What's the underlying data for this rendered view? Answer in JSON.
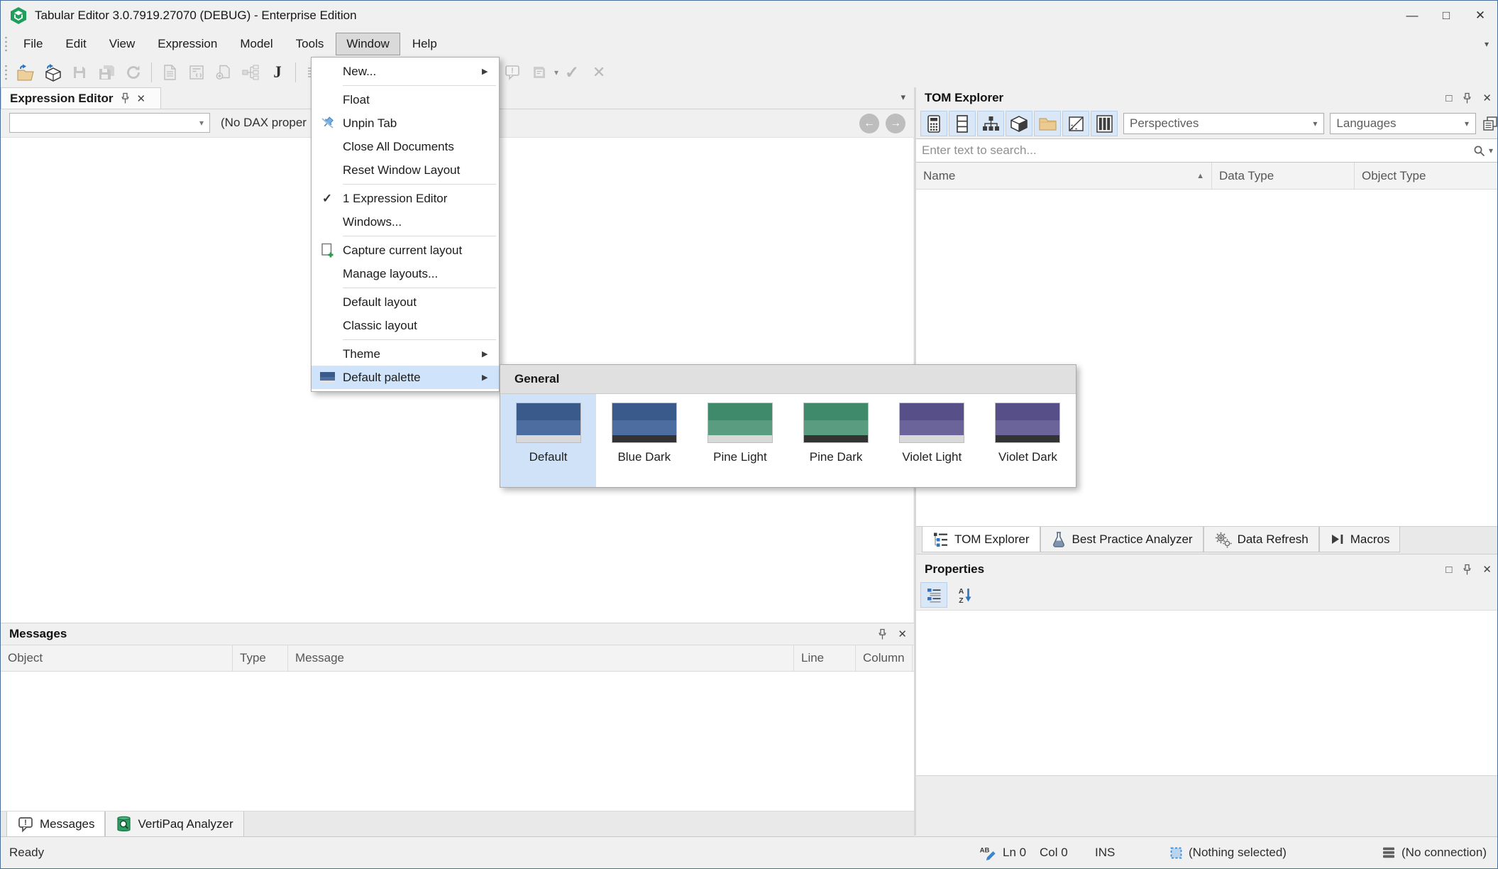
{
  "window": {
    "title": "Tabular Editor 3.0.7919.27070 (DEBUG) - Enterprise Edition",
    "minimize": "—",
    "maximize": "□",
    "close": "✕"
  },
  "menu_bar": {
    "items": [
      "File",
      "Edit",
      "View",
      "Expression",
      "Model",
      "Tools",
      "Window",
      "Help"
    ],
    "active": "Window"
  },
  "toolbar": {
    "items": [
      {
        "icon": "open-file",
        "disabled": false
      },
      {
        "icon": "open-db",
        "disabled": false
      },
      {
        "icon": "save",
        "disabled": true
      },
      {
        "icon": "save-all",
        "disabled": true
      },
      {
        "icon": "refresh",
        "disabled": true
      },
      {
        "sep": true
      },
      {
        "icon": "new-doc",
        "disabled": true
      },
      {
        "icon": "doc-script",
        "disabled": true
      },
      {
        "icon": "doc-import",
        "disabled": true
      },
      {
        "icon": "org-chart",
        "disabled": true
      },
      {
        "icon": "dax-script",
        "disabled": false
      },
      {
        "sep": true
      },
      {
        "icon": "format-lines",
        "disabled": true
      },
      {
        "gap": 242
      },
      {
        "icon": "message-bubble",
        "disabled": true
      },
      {
        "icon": "save-layout",
        "disabled": true,
        "caret": true
      },
      {
        "icon": "check",
        "disabled": true
      },
      {
        "icon": "cancel-x",
        "disabled": true
      }
    ]
  },
  "window_menu": {
    "items": [
      {
        "label": "New...",
        "submenu": true
      },
      {
        "separator": true
      },
      {
        "label": "Float"
      },
      {
        "label": "Unpin Tab",
        "icon": "unpin"
      },
      {
        "label": "Close All Documents"
      },
      {
        "label": "Reset Window Layout"
      },
      {
        "separator": true
      },
      {
        "label": "1 Expression Editor",
        "checked": true
      },
      {
        "label": "Windows..."
      },
      {
        "separator": true
      },
      {
        "label": "Capture current layout",
        "icon": "capture-layout"
      },
      {
        "label": "Manage layouts..."
      },
      {
        "separator": true
      },
      {
        "label": "Default layout"
      },
      {
        "label": "Classic layout"
      },
      {
        "separator": true
      },
      {
        "label": "Theme",
        "submenu": true
      },
      {
        "label": "Default palette",
        "submenu": true,
        "icon": "palette-mini",
        "highlighted": true
      }
    ]
  },
  "palette_submenu": {
    "header": "General",
    "options": [
      {
        "name": "Default",
        "selected": true,
        "colors": [
          "#3a5a8c",
          "#4d6da0",
          "#d9d9d9"
        ]
      },
      {
        "name": "Blue Dark",
        "selected": false,
        "colors": [
          "#3a5a8c",
          "#4d6da0",
          "#333333"
        ]
      },
      {
        "name": "Pine Light",
        "selected": false,
        "colors": [
          "#3f8a6a",
          "#5a9c80",
          "#d9d9d9"
        ]
      },
      {
        "name": "Pine Dark",
        "selected": false,
        "colors": [
          "#3f8a6a",
          "#5a9c80",
          "#333333"
        ]
      },
      {
        "name": "Violet Light",
        "selected": false,
        "colors": [
          "#574f88",
          "#6b649a",
          "#d9d9d9"
        ]
      },
      {
        "name": "Violet Dark",
        "selected": false,
        "colors": [
          "#574f88",
          "#6b649a",
          "#333333"
        ]
      }
    ]
  },
  "expression_editor": {
    "title": "Expression Editor",
    "dropdown_value": "",
    "status_text": "(No DAX proper"
  },
  "tom_explorer": {
    "title": "TOM Explorer",
    "toolbar_buttons": [
      {
        "name": "measures",
        "icon": "calculator"
      },
      {
        "name": "columns",
        "icon": "rows"
      },
      {
        "name": "hierarchies",
        "icon": "blocks"
      },
      {
        "name": "perspectives-cube",
        "icon": "cube-dark"
      },
      {
        "name": "folders",
        "icon": "folder"
      },
      {
        "name": "partitions",
        "icon": "partition"
      },
      {
        "name": "table-columns",
        "icon": "columns3"
      }
    ],
    "perspectives": "Perspectives",
    "languages": "Languages",
    "search_placeholder": "Enter text to search...",
    "columns": [
      "Name",
      "Data Type",
      "Object Type"
    ],
    "sort_column": "Name",
    "tabs": [
      {
        "label": "TOM Explorer",
        "icon": "tree-list",
        "active": true
      },
      {
        "label": "Best Practice Analyzer",
        "icon": "flask",
        "active": false
      },
      {
        "label": "Data Refresh",
        "icon": "gears",
        "active": false
      },
      {
        "label": "Macros",
        "icon": "play-bar",
        "active": false
      }
    ]
  },
  "properties": {
    "title": "Properties",
    "toolbar": [
      {
        "name": "categorized",
        "icon": "categorized",
        "selected": true
      },
      {
        "name": "alphabetical",
        "icon": "sort-az",
        "selected": false
      }
    ]
  },
  "messages": {
    "title": "Messages",
    "columns": [
      "Object",
      "Type",
      "Message",
      "Line",
      "Column"
    ],
    "tabs": [
      {
        "label": "Messages",
        "icon": "bubble-dark",
        "active": true
      },
      {
        "label": "VertiPaq Analyzer",
        "icon": "vertipaq",
        "active": false
      }
    ]
  },
  "status_bar": {
    "ready": "Ready",
    "line": "Ln 0",
    "column": "Col 0",
    "mode": "INS",
    "selection": "(Nothing selected)",
    "connection": "(No connection)"
  },
  "colors": {
    "menu_highlight": "#cfe4fa",
    "toggle_highlight": "#d9e7f7",
    "window_border": "#4a6d99"
  }
}
